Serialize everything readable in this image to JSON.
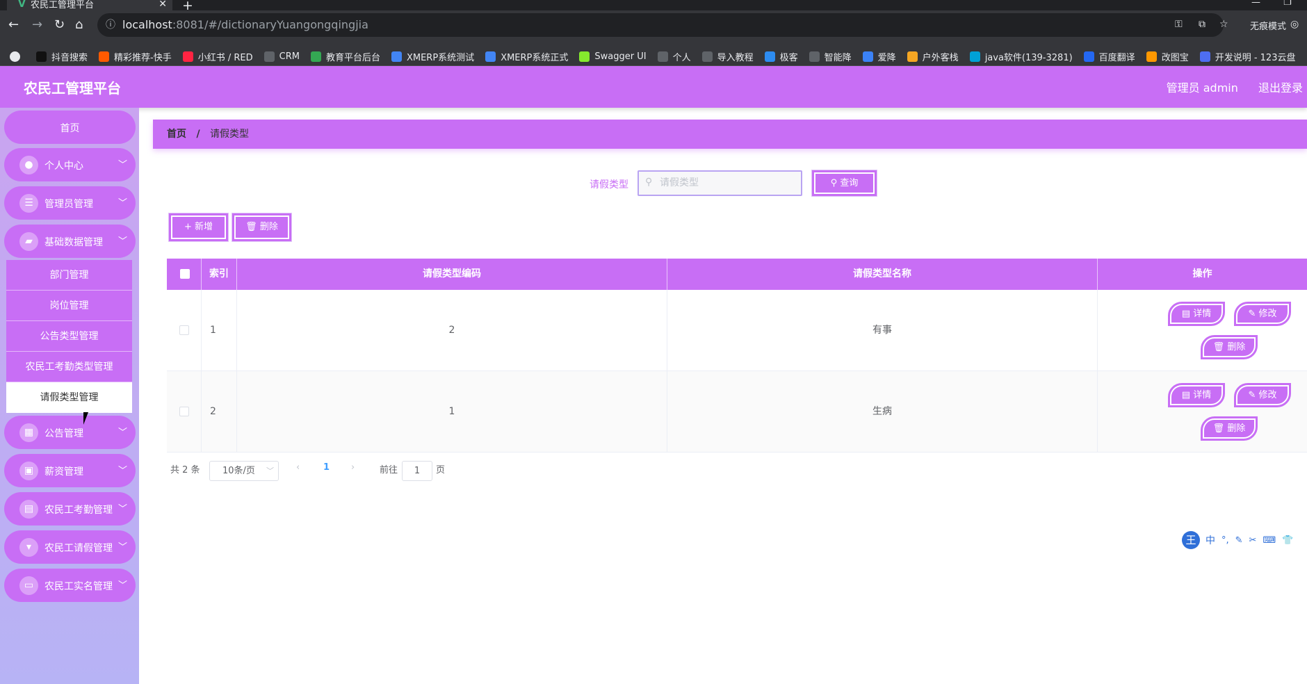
{
  "browser": {
    "tab_title": "农民工管理平台",
    "url_host": "localhost",
    "url_path": ":8081/#/dictionaryYuangongqingjia",
    "incognito_label": "无痕模式",
    "bookmarks": [
      {
        "label": "抖音搜索",
        "color": "#111111"
      },
      {
        "label": "精彩推荐-快手",
        "color": "#ff5a00"
      },
      {
        "label": "小红书 / RED",
        "color": "#ff2442"
      },
      {
        "label": "CRM",
        "color": "#5f6368"
      },
      {
        "label": "教育平台后台",
        "color": "#34a853"
      },
      {
        "label": "XMERP系统测试",
        "color": "#4285f4"
      },
      {
        "label": "XMERP系统正式",
        "color": "#4285f4"
      },
      {
        "label": "Swagger UI",
        "color": "#85ea2d"
      },
      {
        "label": "个人",
        "color": "#5f6368"
      },
      {
        "label": "导入教程",
        "color": "#5f6368"
      },
      {
        "label": "极客",
        "color": "#2d8cf0"
      },
      {
        "label": "智能降",
        "color": "#5f6368"
      },
      {
        "label": "爱降",
        "color": "#3b82f6"
      },
      {
        "label": "户外客栈",
        "color": "#f5a623"
      },
      {
        "label": "java软件(139-3281)",
        "color": "#00a1d6"
      },
      {
        "label": "百度翻译",
        "color": "#2468f2"
      },
      {
        "label": "改图宝",
        "color": "#ff9800"
      },
      {
        "label": "开发说明 - 123云盘",
        "color": "#4e6ef2"
      }
    ]
  },
  "header": {
    "title": "农民工管理平台",
    "user": "管理员 admin",
    "logout": "退出登录"
  },
  "sidebar": {
    "home": "首页",
    "menus": [
      {
        "label": "个人中心",
        "icon": "user-icon"
      },
      {
        "label": "管理员管理",
        "icon": "sliders-icon"
      },
      {
        "label": "基础数据管理",
        "icon": "ticket-icon"
      }
    ],
    "submenus": [
      "部门管理",
      "岗位管理",
      "公告类型管理",
      "农民工考勤类型管理",
      "请假类型管理"
    ],
    "menus_after": [
      {
        "label": "公告管理",
        "icon": "grid-icon"
      },
      {
        "label": "薪资管理",
        "icon": "briefcase-icon"
      },
      {
        "label": "农民工考勤管理",
        "icon": "clipboard-icon"
      },
      {
        "label": "农民工请假管理",
        "icon": "stamp-icon"
      },
      {
        "label": "农民工实名管理",
        "icon": "monitor-icon"
      }
    ]
  },
  "breadcrumb": {
    "home": "首页",
    "separator": "/",
    "current": "请假类型"
  },
  "search": {
    "label": "请假类型",
    "placeholder": "请假类型",
    "button": "查询"
  },
  "toolbar": {
    "add": "+ 新增",
    "delete": "删除"
  },
  "table": {
    "columns": [
      "索引",
      "请假类型编码",
      "请假类型名称",
      "操作"
    ],
    "rows": [
      {
        "index": "1",
        "code": "2",
        "name": "有事"
      },
      {
        "index": "2",
        "code": "1",
        "name": "生病"
      }
    ],
    "actions": {
      "detail": "详情",
      "edit": "修改",
      "delete": "删除"
    }
  },
  "pagination": {
    "total": "共 2 条",
    "page_size": "10条/页",
    "current": "1",
    "goto_prefix": "前往",
    "goto_value": "1",
    "goto_suffix": "页"
  },
  "ime": {
    "items": [
      "中",
      "°,",
      "✎",
      "✂",
      "⌨",
      "👕"
    ]
  },
  "colors": {
    "accent": "#c86ef5",
    "sidebar_top": "#c9a4f0",
    "sidebar_bottom": "#b7b3f5"
  }
}
